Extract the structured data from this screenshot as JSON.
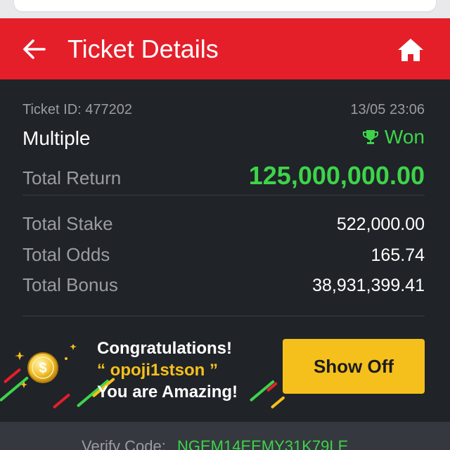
{
  "header": {
    "title": "Ticket Details"
  },
  "ticket": {
    "id_label": "Ticket ID: 477202",
    "datetime": "13/05 23:06",
    "bet_type": "Multiple",
    "status": "Won",
    "total_return_label": "Total Return",
    "total_return": "125,000,000.00",
    "total_stake_label": "Total Stake",
    "total_stake": "522,000.00",
    "total_odds_label": "Total Odds",
    "total_odds": "165.74",
    "total_bonus_label": "Total Bonus",
    "total_bonus": "38,931,399.41"
  },
  "promo": {
    "line1": "Congratulations!",
    "username": "“ opoji1stson ”",
    "line3": "You are Amazing!",
    "button": "Show Off"
  },
  "verify": {
    "label": "Verify Code:",
    "code": "NGEM14EEMY31K79LE"
  },
  "icons": {
    "back": "arrow-left-icon",
    "home": "home-icon",
    "trophy": "trophy-icon",
    "coin": "dollar-coin-icon"
  },
  "colors": {
    "header": "#e41f2a",
    "panel": "#202328",
    "won_green": "#3dd44a",
    "accent_yellow": "#f5c01c"
  }
}
